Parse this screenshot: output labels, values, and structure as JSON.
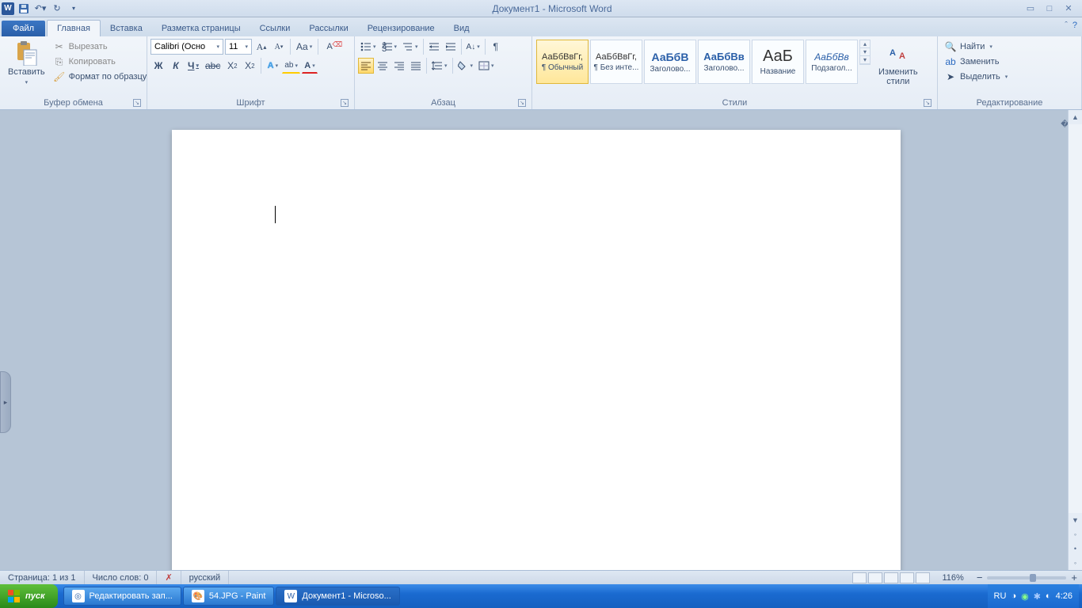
{
  "title": "Документ1 - Microsoft Word",
  "qat": {
    "app_letter": "W"
  },
  "tabs": {
    "file": "Файл",
    "items": [
      "Главная",
      "Вставка",
      "Разметка страницы",
      "Ссылки",
      "Рассылки",
      "Рецензирование",
      "Вид"
    ],
    "active_index": 0
  },
  "clipboard": {
    "paste": "Вставить",
    "cut": "Вырезать",
    "copy": "Копировать",
    "format_painter": "Формат по образцу",
    "group": "Буфер обмена"
  },
  "font": {
    "name": "Calibri (Осно",
    "size": "11",
    "group": "Шрифт",
    "bold": "Ж",
    "italic": "К",
    "underline": "Ч"
  },
  "paragraph": {
    "group": "Абзац"
  },
  "styles": {
    "group": "Стили",
    "change": "Изменить\nстили",
    "items": [
      {
        "preview": "АаБбВвГг,",
        "name": "¶ Обычный",
        "active": true,
        "size": "11px",
        "color": "#333"
      },
      {
        "preview": "АаБбВвГг,",
        "name": "¶ Без инте...",
        "size": "11px",
        "color": "#333"
      },
      {
        "preview": "АаБбВ",
        "name": "Заголово...",
        "size": "14px",
        "color": "#2a5fa8",
        "bold": true
      },
      {
        "preview": "АаБбВв",
        "name": "Заголово...",
        "size": "13px",
        "color": "#2a5fa8",
        "bold": true
      },
      {
        "preview": "АаБ",
        "name": "Название",
        "size": "20px",
        "color": "#333"
      },
      {
        "preview": "АаБбВв",
        "name": "Подзагол...",
        "size": "12px",
        "color": "#2a5fa8",
        "italic": true
      }
    ]
  },
  "editing": {
    "group": "Редактирование",
    "find": "Найти",
    "replace": "Заменить",
    "select": "Выделить"
  },
  "status": {
    "page": "Страница: 1 из 1",
    "words": "Число слов: 0",
    "language": "русский",
    "zoom": "116%"
  },
  "taskbar": {
    "start": "пуск",
    "items": [
      {
        "label": "Редактировать зап...",
        "icon": "◎"
      },
      {
        "label": "54.JPG - Paint",
        "icon": "🎨"
      },
      {
        "label": "Документ1 - Microso...",
        "icon": "W",
        "active": true
      }
    ],
    "lang": "RU",
    "clock": "4:26"
  }
}
